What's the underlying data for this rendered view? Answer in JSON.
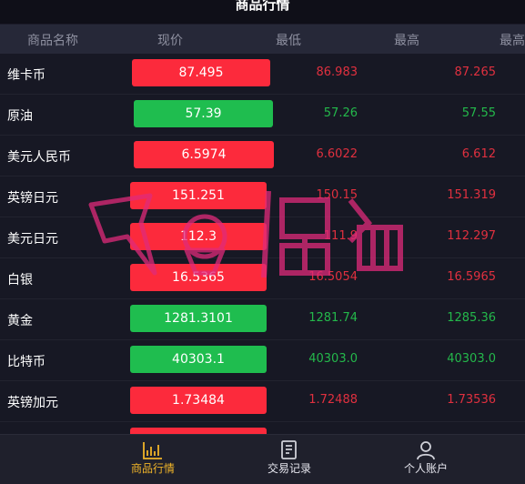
{
  "title": "商品行情",
  "columns": [
    "商品名称",
    "现价",
    "最低",
    "最高",
    "最高"
  ],
  "rows": [
    {
      "name": "维卡币",
      "price": "87.495",
      "low": "86.983",
      "high": "87.265",
      "trend": "down"
    },
    {
      "name": "原油",
      "price": "57.39",
      "low": "57.26",
      "high": "57.55",
      "trend": "up"
    },
    {
      "name": "美元人民币",
      "price": "6.5974",
      "low": "6.6022",
      "high": "6.612",
      "trend": "down"
    },
    {
      "name": "英镑日元",
      "price": "151.251",
      "low": "150.15",
      "high": "151.319",
      "trend": "down"
    },
    {
      "name": "美元日元",
      "price": "112.3",
      "low": "111.9",
      "high": "112.297",
      "trend": "down"
    },
    {
      "name": "白银",
      "price": "16.5365",
      "low": "16.5054",
      "high": "16.5965",
      "trend": "down"
    },
    {
      "name": "黄金",
      "price": "1281.3101",
      "low": "1281.74",
      "high": "1285.36",
      "trend": "up"
    },
    {
      "name": "比特币",
      "price": "40303.1",
      "low": "40303.0",
      "high": "40303.0",
      "trend": "up"
    },
    {
      "name": "英镑加元",
      "price": "1.73484",
      "low": "1.72488",
      "high": "1.73536",
      "trend": "down"
    }
  ],
  "tabs": [
    {
      "label": "商品行情",
      "icon": "chart-icon",
      "active": true
    },
    {
      "label": "交易记录",
      "icon": "document-icon",
      "active": false
    },
    {
      "label": "个人账户",
      "icon": "user-icon",
      "active": false
    }
  ],
  "colors": {
    "up": "#1fbd4f",
    "down": "#fc2a3c",
    "active_tab": "#f0b429",
    "background": "#151522"
  }
}
